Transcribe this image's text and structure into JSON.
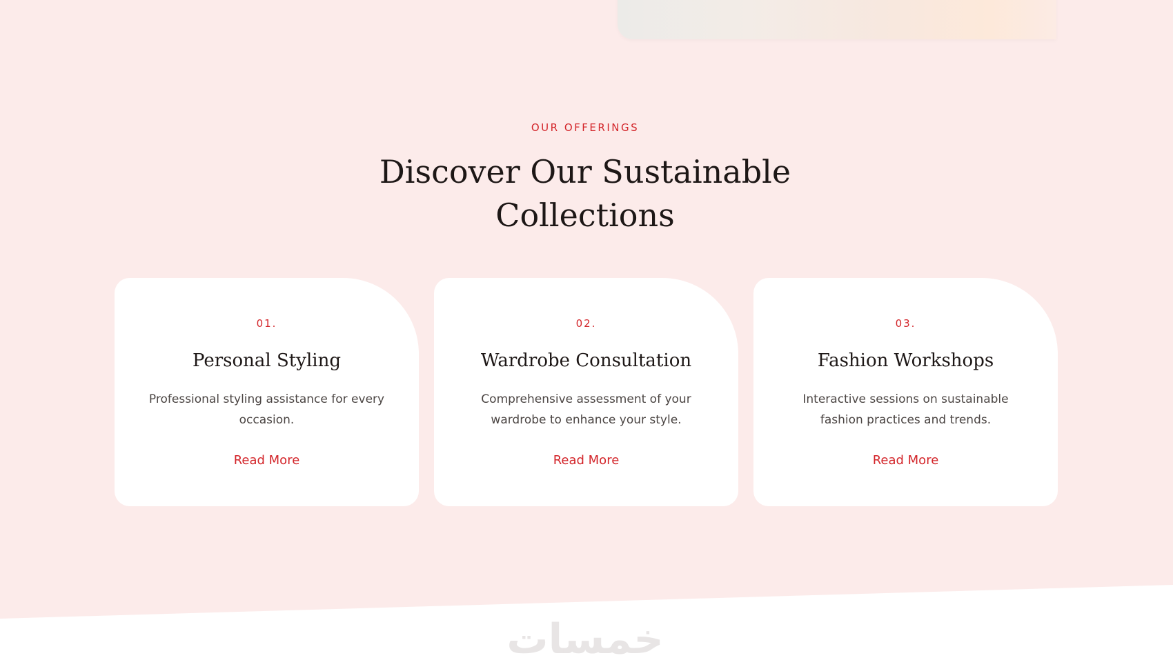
{
  "offerings": {
    "eyebrow": "OUR OFFERINGS",
    "headline": "Discover Our Sustainable Collections"
  },
  "cards": [
    {
      "number": "01.",
      "title": "Personal Styling",
      "description": "Professional styling assistance for every occasion.",
      "link_label": "Read More"
    },
    {
      "number": "02.",
      "title": "Wardrobe Consultation",
      "description": "Comprehensive assessment of your wardrobe to enhance your style.",
      "link_label": "Read More"
    },
    {
      "number": "03.",
      "title": "Fashion Workshops",
      "description": "Interactive sessions on sustainable fashion practices and trends.",
      "link_label": "Read More"
    }
  ],
  "watermark": "خمسات",
  "colors": {
    "background": "#fcebea",
    "accent": "#d3252a",
    "heading": "#1d1716",
    "body_text": "#4b4543",
    "card": "#ffffff"
  }
}
